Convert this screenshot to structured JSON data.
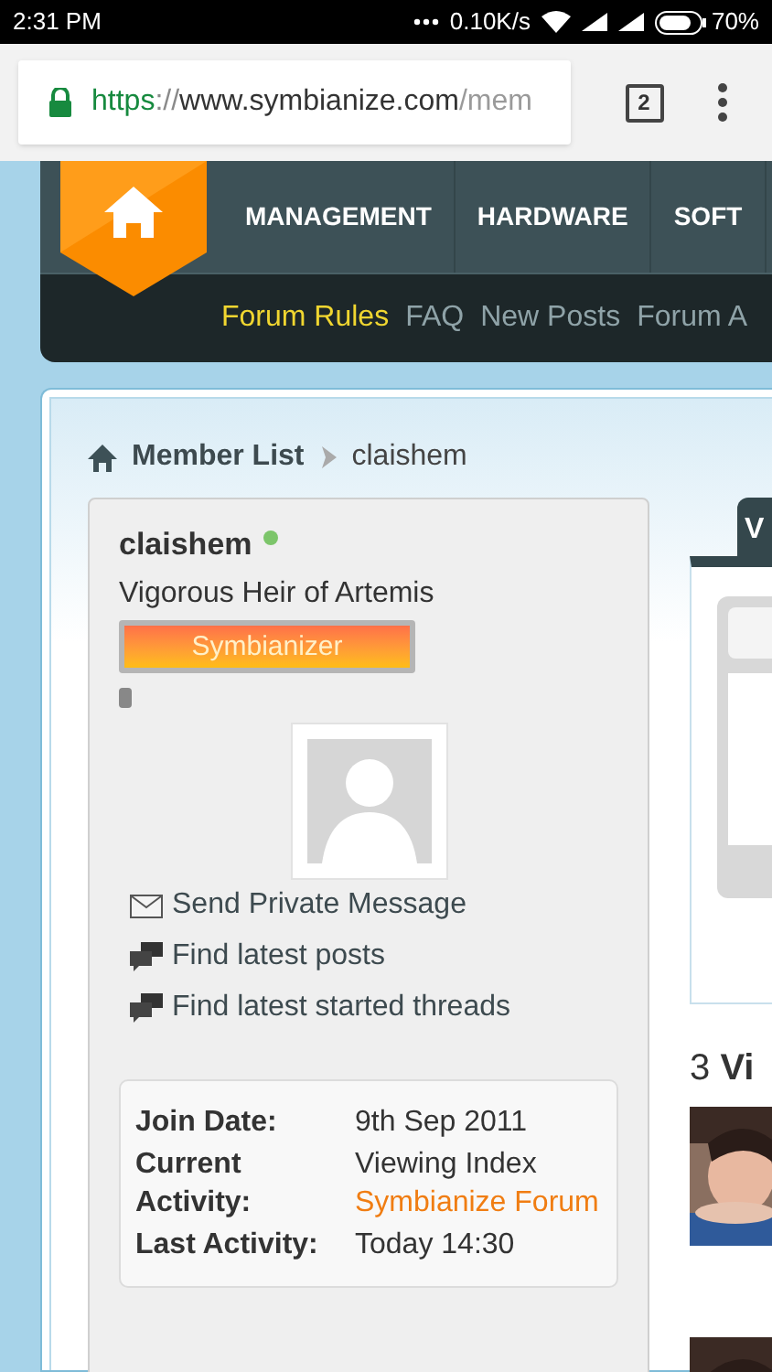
{
  "status_bar": {
    "time": "2:31 PM",
    "network_speed": "0.10K/s",
    "battery": "70%"
  },
  "browser": {
    "url_scheme": "https",
    "url_separator": "://",
    "url_host": "www.symbianize.com",
    "url_path": "/mem",
    "tab_count": "2"
  },
  "nav": {
    "items": [
      "MANAGEMENT",
      "HARDWARE",
      "SOFT"
    ],
    "sublinks": [
      {
        "label": "Forum Rules",
        "highlighted": true
      },
      {
        "label": "FAQ",
        "highlighted": false
      },
      {
        "label": "New Posts",
        "highlighted": false
      },
      {
        "label": "Forum A",
        "highlighted": false
      }
    ]
  },
  "breadcrumb": [
    "Member List",
    "claishem"
  ],
  "profile": {
    "username": "claishem",
    "online": true,
    "title": "Vigorous Heir of Artemis",
    "rank_badge": "Symbianizer",
    "actions": [
      {
        "kind": "message",
        "label": "Send Private Message"
      },
      {
        "kind": "posts",
        "label": "Find latest posts"
      },
      {
        "kind": "posts",
        "label": "Find latest started threads"
      }
    ],
    "details": [
      {
        "label": "Join Date:",
        "value": "9th Sep 2011"
      },
      {
        "label": "Current Activity:",
        "value": "Viewing Index",
        "link": "Symbianize Forum"
      },
      {
        "label": "Last Activity:",
        "value": "Today 14:30"
      }
    ]
  },
  "side": {
    "tab_label": "V",
    "visitors_heading": "3 **Vi**"
  }
}
